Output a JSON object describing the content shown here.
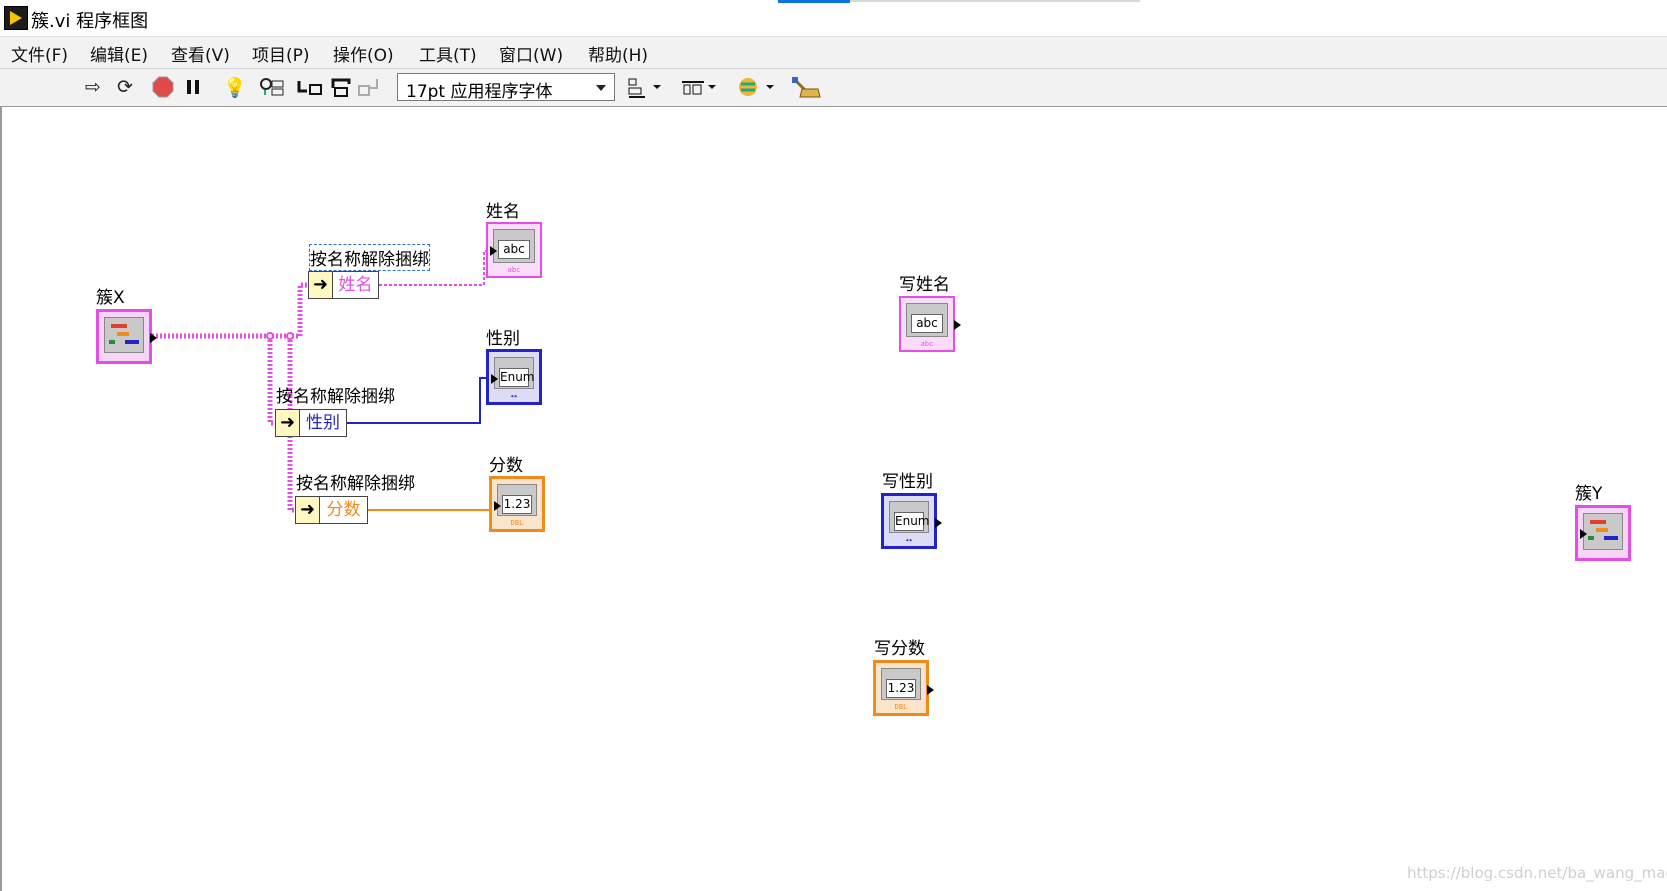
{
  "window": {
    "title": "簇.vi 程序框图"
  },
  "menu": [
    "文件(F)",
    "编辑(E)",
    "查看(V)",
    "项目(P)",
    "操作(O)",
    "工具(T)",
    "窗口(W)",
    "帮助(H)"
  ],
  "toolbar": {
    "font_select": "17pt 应用程序字体"
  },
  "diagram": {
    "cluster_in_label": "簇X",
    "cluster_out_label": "簇Y",
    "unbundle_caption": "按名称解除捆绑",
    "unbundles": [
      {
        "element": "姓名",
        "color": "#e44ee4"
      },
      {
        "element": "性别",
        "color": "#2323c8"
      },
      {
        "element": "分数",
        "color": "#f08a1c"
      }
    ],
    "indicators": [
      {
        "label": "姓名",
        "face": "abc",
        "tag": "abc"
      },
      {
        "label": "性别",
        "face": "Enum",
        "tag": "◂▸"
      },
      {
        "label": "分数",
        "face": "1.23",
        "tag": "DBL"
      }
    ],
    "controls": [
      {
        "label": "写姓名",
        "face": "abc",
        "tag": "abc"
      },
      {
        "label": "写性别",
        "face": "Enum",
        "tag": "◂▸"
      },
      {
        "label": "写分数",
        "face": "1.23",
        "tag": "DBL"
      }
    ]
  },
  "colors": {
    "string_wire": "#e44ee4",
    "enum_wire": "#2323c8",
    "numeric_wire": "#f08a1c"
  },
  "watermark": "https://blog.csdn.net/ba_wang_mao"
}
